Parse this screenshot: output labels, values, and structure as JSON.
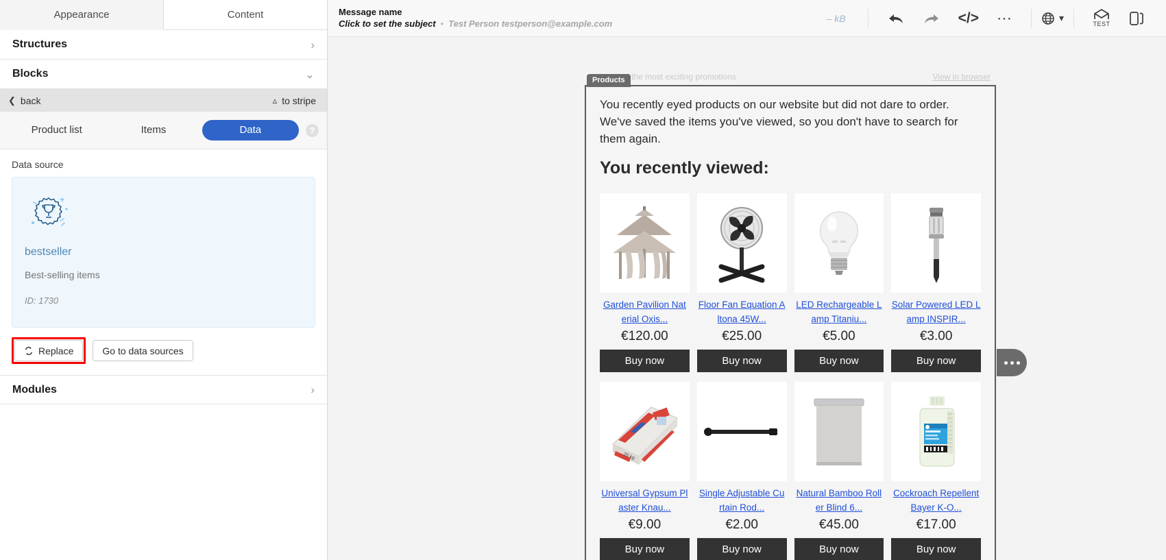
{
  "left_panel": {
    "tabs": [
      {
        "label": "Appearance",
        "active": true
      },
      {
        "label": "Content",
        "active": false
      }
    ],
    "sections": [
      {
        "label": "Structures",
        "icon": "chevron-right-icon"
      },
      {
        "label": "Blocks",
        "icon": "chevron-down-icon"
      },
      {
        "label": "Modules",
        "icon": "chevron-right-icon"
      }
    ],
    "back_bar": {
      "back_label": "back",
      "back_icon": "chevron-left-icon",
      "to_stripe_label": "to stripe",
      "to_stripe_icon": "chevron-up-icon"
    },
    "segments": [
      {
        "label": "Product list",
        "active": false
      },
      {
        "label": "Items",
        "active": false
      },
      {
        "label": "Data",
        "active": true
      }
    ],
    "help_icon_label": "?",
    "data_source": {
      "section_label": "Data source",
      "icon": "trophy-badge-icon",
      "name": "bestseller",
      "description": "Best-selling items",
      "id_label": "ID: 1730",
      "replace_button": "Replace",
      "replace_icon": "refresh-icon",
      "go_to_sources_button": "Go to data sources",
      "highlight_color": "#f60000"
    }
  },
  "topbar": {
    "message_name": "Message name",
    "subject_placeholder": "Click to set the subject",
    "separator": "•",
    "recipient": "Test Person testperson@example.com",
    "size": "– kB",
    "icons": [
      {
        "name": "undo-icon"
      },
      {
        "name": "redo-icon"
      },
      {
        "name": "code-icon"
      },
      {
        "name": "more-options-icon"
      },
      {
        "name": "globe-language-icon"
      },
      {
        "name": "chevron-down-icon"
      },
      {
        "name": "test-send-icon"
      },
      {
        "name": "preview-device-icon"
      }
    ]
  },
  "email": {
    "block_tag": "Products",
    "preheader": "der of the most exciting promotions",
    "view_in_browser": "View in browser",
    "intro": "You recently eyed products on our website but did not dare to order. We've saved the items you've viewed, so you don't have to search for them again.",
    "headline": "You recently viewed:",
    "buy_label": "Buy now",
    "products": [
      {
        "name": "Garden Pavilion Nat erial Oxis...",
        "price": "€120.00",
        "icon": "gazebo-icon"
      },
      {
        "name": "Floor Fan Equation A ltona 45W...",
        "price": "€25.00",
        "icon": "floor-fan-icon"
      },
      {
        "name": "LED Rechargeable L amp Titaniu...",
        "price": "€5.00",
        "icon": "led-bulb-icon"
      },
      {
        "name": "Solar Powered LED Lamp INSPIR...",
        "price": "€3.00",
        "icon": "solar-lamp-icon"
      },
      {
        "name": "Universal Gypsum Pl aster Knau...",
        "price": "€9.00",
        "icon": "plaster-bag-icon"
      },
      {
        "name": "Single Adjustable Cu rtain Rod...",
        "price": "€2.00",
        "icon": "curtain-rod-icon"
      },
      {
        "name": "Natural Bamboo Roll er Blind 6...",
        "price": "€45.00",
        "icon": "roller-blind-icon"
      },
      {
        "name": "Cockroach Repellent Bayer K-O...",
        "price": "€17.00",
        "icon": "repellent-bottle-icon"
      }
    ]
  }
}
